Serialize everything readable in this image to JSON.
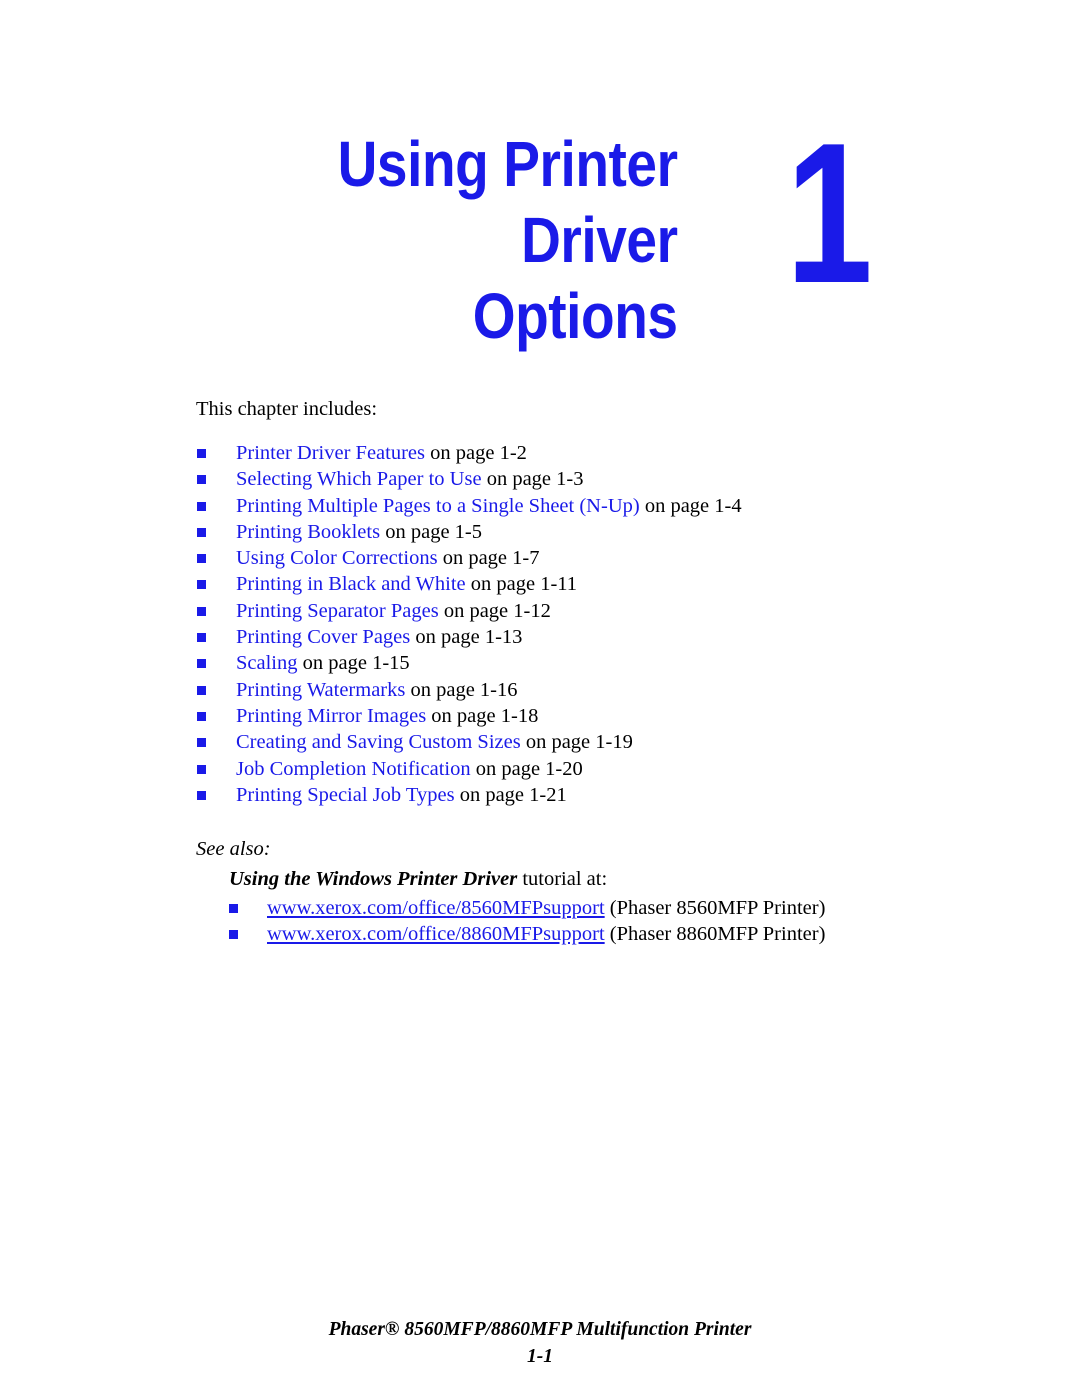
{
  "colors": {
    "link_blue": "#1a1ae8",
    "text_black": "#000000",
    "page_background": "#ffffff"
  },
  "chapter": {
    "title": "Using Printer Driver\nOptions",
    "number": "1"
  },
  "body": {
    "intro": "This chapter includes:",
    "toc_items": [
      {
        "link": "Printer Driver Features",
        "suffix": " on page 1-2"
      },
      {
        "link": "Selecting Which Paper to Use",
        "suffix": " on page 1-3"
      },
      {
        "link": "Printing Multiple Pages to a Single Sheet (N-Up)",
        "suffix": " on page 1-4"
      },
      {
        "link": "Printing Booklets",
        "suffix": " on page 1-5"
      },
      {
        "link": "Using Color Corrections",
        "suffix": " on page 1-7"
      },
      {
        "link": "Printing in Black and White",
        "suffix": " on page 1-11"
      },
      {
        "link": "Printing Separator Pages",
        "suffix": " on page 1-12"
      },
      {
        "link": "Printing Cover Pages",
        "suffix": " on page 1-13"
      },
      {
        "link": "Scaling",
        "suffix": " on page 1-15"
      },
      {
        "link": "Printing Watermarks",
        "suffix": " on page 1-16"
      },
      {
        "link": "Printing Mirror Images",
        "suffix": " on page 1-18"
      },
      {
        "link": "Creating and Saving Custom Sizes",
        "suffix": " on page 1-19"
      },
      {
        "link": "Job Completion Notification",
        "suffix": " on page 1-20"
      },
      {
        "link": "Printing Special Job Types",
        "suffix": " on page 1-21"
      }
    ]
  },
  "see_also": {
    "label": "See also:",
    "tutorial_title": "Using the Windows Printer Driver",
    "tutorial_suffix": " tutorial at:",
    "links": [
      {
        "url": "www.xerox.com/office/8560MFPsupport",
        "suffix": " (Phaser 8560MFP Printer)"
      },
      {
        "url": "www.xerox.com/office/8860MFPsupport",
        "suffix": " (Phaser 8860MFP Printer)"
      }
    ]
  },
  "footer": {
    "product": "Phaser® 8560MFP/8860MFP Multifunction Printer",
    "page_number": "1-1"
  }
}
